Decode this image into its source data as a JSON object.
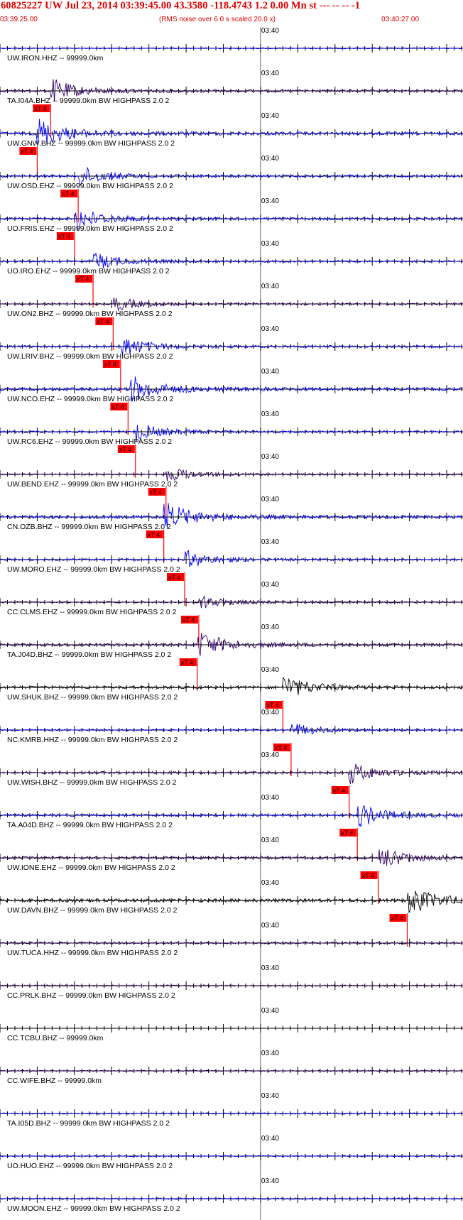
{
  "header": {
    "title": "60825227 UW Jul 23, 2014 03:39:45.00   43.3580 -118.4743  1.2 0.00 Mn st --- -- --  -1",
    "start_time": "03:39:25.00",
    "note": "(RMS noise over 6.0 s scaled 20.0 x)",
    "end_time": "03:40:27.00"
  },
  "colors": {
    "header_text": "#e00000",
    "grid_line": "#000000",
    "trace_blue": "#0000ff",
    "trace_dark": "#330066",
    "trace_black": "#000000",
    "pick_marker": "#ff0000"
  },
  "chart_data": {
    "type": "line",
    "time_window": {
      "start": "03:39:25.00",
      "end": "03:40:27.00"
    },
    "mid_tick_label": "03:40",
    "tick_interval_seconds": 1,
    "traces": [
      {
        "label": "UW.IRON.HHZ -- 99999.0km",
        "pick": null,
        "color": "#0000ff",
        "amp": 0.4
      },
      {
        "label": "TA.I04A.BHZ -- 99999.0km BW  HIGHPASS  2.0  2",
        "pick": {
          "label": "xT 4",
          "time": "03:39:31.8"
        },
        "color": "#330066",
        "amp": 0.8
      },
      {
        "label": "UW.GNW.BHZ -- 99999.0km BW  HIGHPASS  2.0  2",
        "pick": {
          "label": "xT 4",
          "time": "03:39:30.0"
        },
        "color": "#0000ff",
        "amp": 1.0
      },
      {
        "label": "UW.OSD.EHZ -- 99999.0km BW  HIGHPASS  2.0  2",
        "pick": {
          "label": "xT 4",
          "time": "03:39:35.5"
        },
        "color": "#0000ff",
        "amp": 0.7
      },
      {
        "label": "UO.FRIS.EHZ -- 99999.0km BW  HIGHPASS  2.0  2",
        "pick": {
          "label": "xT 4",
          "time": "03:39:35.0"
        },
        "color": "#0000ff",
        "amp": 0.8
      },
      {
        "label": "UO.IRO.EHZ -- 99999.0km BW  HIGHPASS  2.0  2",
        "pick": {
          "label": "xT 4",
          "time": "03:39:37.5"
        },
        "color": "#0000ff",
        "amp": 0.6
      },
      {
        "label": "UW.ON2.BHZ -- 99999.0km BW  HIGHPASS  2.0  2",
        "pick": {
          "label": "xT 4",
          "time": "03:39:40.2"
        },
        "color": "#330066",
        "amp": 0.5
      },
      {
        "label": "UW.LRIV.BHZ -- 99999.0km BW  HIGHPASS  2.0  2",
        "pick": {
          "label": "xT 4",
          "time": "03:39:41.2"
        },
        "color": "#0000ff",
        "amp": 0.7
      },
      {
        "label": "UW.NCO.EHZ -- 99999.0km BW  HIGHPASS  2.0  2",
        "pick": {
          "label": "xT 4",
          "time": "03:39:42.2"
        },
        "color": "#0000ff",
        "amp": 1.0
      },
      {
        "label": "UW.RC6.EHZ -- 99999.0km BW  HIGHPASS  2.0  2",
        "pick": {
          "label": "xT 4",
          "time": "03:39:43.2"
        },
        "color": "#0000ff",
        "amp": 0.6
      },
      {
        "label": "UW.BEND.EHZ -- 99999.0km BW  HIGHPASS  2.0  2",
        "pick": {
          "label": "xT 4",
          "time": "03:39:47.3"
        },
        "color": "#330066",
        "amp": 0.5
      },
      {
        "label": "CN.OZB.BHZ -- 99999.0km BW  HIGHPASS  2.0  2",
        "pick": {
          "label": "xT 4",
          "time": "03:39:47.0"
        },
        "color": "#0000ff",
        "amp": 1.0
      },
      {
        "label": "UW.MORO.EHZ -- 99999.0km BW  HIGHPASS  2.0  2",
        "pick": {
          "label": "xT 4",
          "time": "03:39:49.8"
        },
        "color": "#0000ff",
        "amp": 0.6
      },
      {
        "label": "CC.CLMS.EHZ -- 99999.0km BW  HIGHPASS  2.0  2",
        "pick": {
          "label": "xT 4",
          "time": "03:39:51.7"
        },
        "color": "#330066",
        "amp": 0.5
      },
      {
        "label": "TA.J04D.BHZ -- 99999.0km BW  HIGHPASS  2.0  2",
        "pick": {
          "label": "xT 4",
          "time": "03:39:51.5"
        },
        "color": "#330066",
        "amp": 0.9
      },
      {
        "label": "UW.SHUK.BHZ -- 99999.0km BW  HIGHPASS  2.0  2",
        "pick": {
          "label": "xT 4",
          "time": "03:40:03.0"
        },
        "color": "#000000",
        "amp": 0.8
      },
      {
        "label": "NC.KMRB.HHZ -- 99999.0km BW  HIGHPASS  2.0  2",
        "pick": {
          "label": "xT 4",
          "time": "03:40:04.1"
        },
        "color": "#0000ff",
        "amp": 0.5
      },
      {
        "label": "UW.WISH.BHZ -- 99999.0km BW  HIGHPASS  2.0  2",
        "pick": {
          "label": "xT 4",
          "time": "03:40:11.9"
        },
        "color": "#330066",
        "amp": 0.7
      },
      {
        "label": "TA.A04D.BHZ -- 99999.0km BW  HIGHPASS  2.0  2",
        "pick": {
          "label": "xT 4",
          "time": "03:40:13.0"
        },
        "color": "#0000ff",
        "amp": 0.8
      },
      {
        "label": "UW.IONE.EHZ -- 99999.0km BW  HIGHPASS  2.0  2",
        "pick": {
          "label": "xT 4",
          "time": "03:40:15.8"
        },
        "color": "#330066",
        "amp": 0.8
      },
      {
        "label": "UW.DAVN.BHZ -- 99999.0km BW  HIGHPASS  2.0  2",
        "pick": {
          "label": "xT 4",
          "time": "03:40:19.7"
        },
        "color": "#000000",
        "amp": 1.0
      },
      {
        "label": "UW.TUCA.HHZ -- 99999.0km BW  HIGHPASS  2.0  2",
        "pick": null,
        "color": "#330066",
        "amp": 0.6
      },
      {
        "label": "CC.PRLK.BHZ -- 99999.0km BW  HIGHPASS  2.0  2",
        "pick": null,
        "color": "#330066",
        "amp": 0.5
      },
      {
        "label": "CC.TCBU.BHZ -- 99999.0km",
        "pick": null,
        "color": "#ffffff",
        "amp": 0.0
      },
      {
        "label": "CC.WIFE.BHZ -- 99999.0km",
        "pick": null,
        "color": "#330066",
        "amp": 0.4
      },
      {
        "label": "TA.I05D.BHZ -- 99999.0km BW  HIGHPASS  2.0  2",
        "pick": null,
        "color": "#0000ff",
        "amp": 0.5
      },
      {
        "label": "UO.HUO.EHZ -- 99999.0km BW  HIGHPASS  2.0  2",
        "pick": null,
        "color": "#0000ff",
        "amp": 0.4
      },
      {
        "label": "UW.MOON.EHZ -- 99999.0km BW  HIGHPASS  2.0  2",
        "pick": null,
        "color": "#0000ff",
        "amp": 0.5
      }
    ]
  }
}
